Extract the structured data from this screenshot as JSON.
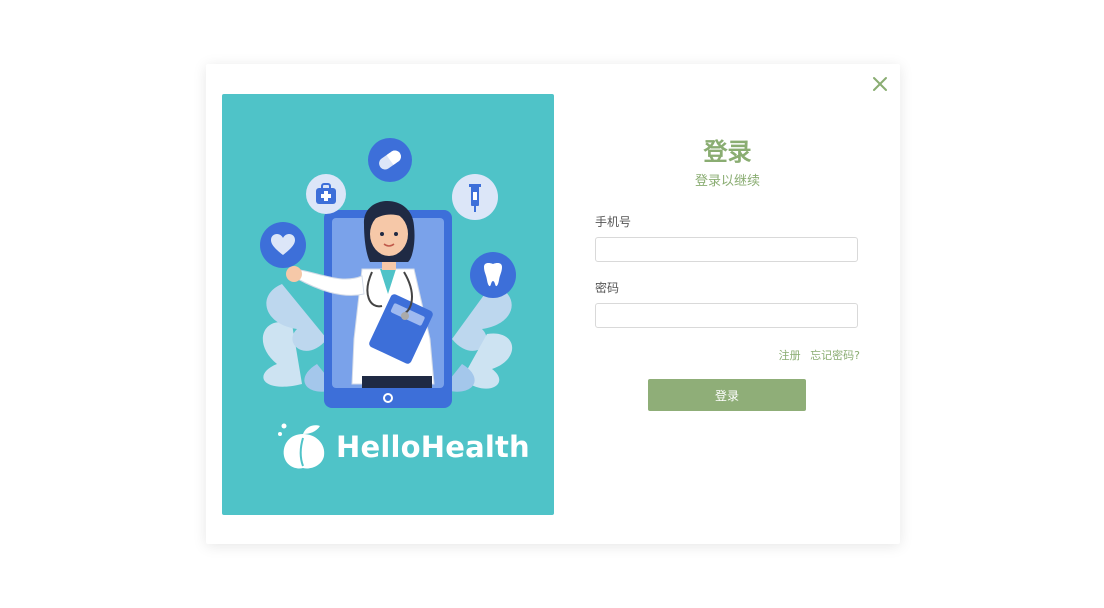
{
  "brand": {
    "name": "HelloHealth"
  },
  "login": {
    "title": "登录",
    "subtitle": "登录以继续",
    "phone_label": "手机号",
    "phone_value": "",
    "password_label": "密码",
    "password_value": "",
    "register_link": "注册",
    "forgot_link": "忘记密码?",
    "submit_label": "登录"
  },
  "colors": {
    "accent_green": "#8aad72",
    "button_green": "#8fae78",
    "illustration_bg": "#4fc3c8",
    "icon_blue": "#3d6fd9"
  },
  "icons": [
    "close-icon",
    "heart-icon",
    "first-aid-kit-icon",
    "pill-icon",
    "syringe-icon",
    "tooth-icon",
    "peach-logo-icon"
  ]
}
